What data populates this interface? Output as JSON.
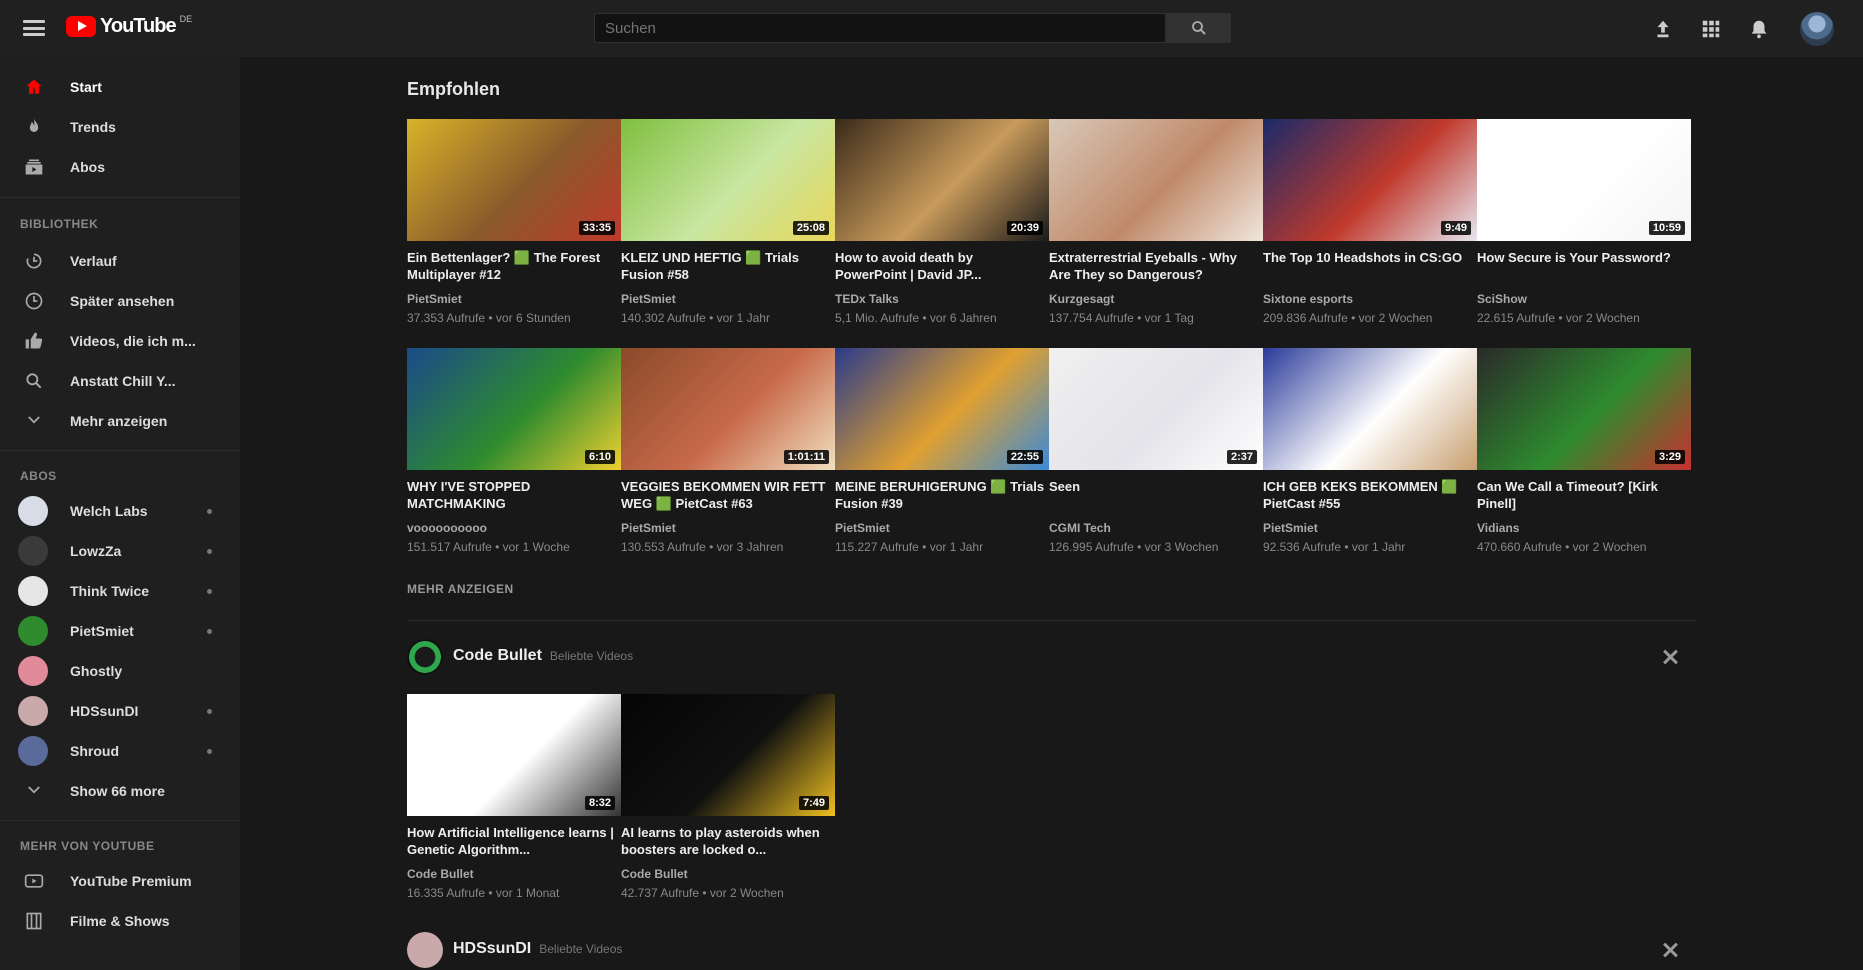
{
  "header": {
    "logo_text": "YouTube",
    "logo_sup": "DE",
    "search_placeholder": "Suchen"
  },
  "sidebar": {
    "main_items": [
      {
        "label": "Start",
        "icon": "home-icon"
      },
      {
        "label": "Trends",
        "icon": "flame-icon"
      },
      {
        "label": "Abos",
        "icon": "subscriptions-icon"
      }
    ],
    "library_heading": "BIBLIOTHEK",
    "library_items": [
      {
        "label": "Verlauf",
        "icon": "history-icon"
      },
      {
        "label": "Später ansehen",
        "icon": "clock-icon"
      },
      {
        "label": "Videos, die ich m...",
        "icon": "thumbs-up-icon"
      },
      {
        "label": "Anstatt Chill Y...",
        "icon": "playlist-icon"
      },
      {
        "label": "Mehr anzeigen",
        "icon": "chevron-down-icon"
      }
    ],
    "abos_heading": "ABOS",
    "subscriptions": [
      {
        "label": "Welch Labs",
        "color": "#d8dce6"
      },
      {
        "label": "LowzZa",
        "color": "#3a3a3a"
      },
      {
        "label": "Think Twice",
        "color": "#e6e6e6"
      },
      {
        "label": "PietSmiet",
        "color": "#2e8b2e"
      },
      {
        "label": "Ghostly",
        "color": "#e08a9a"
      },
      {
        "label": "HDSsunDI",
        "color": "#c9a9a9"
      },
      {
        "label": "Shroud",
        "color": "#5a6a9a"
      },
      {
        "label": "Show 66 more",
        "color": ""
      }
    ],
    "more_heading": "MEHR VON YOUTUBE",
    "more_items": [
      {
        "label": "YouTube Premium",
        "icon": "premium-icon"
      },
      {
        "label": "Filme & Shows",
        "icon": "film-icon"
      }
    ]
  },
  "main": {
    "recommended_title": "Empfohlen",
    "show_more": "MEHR ANZEIGEN",
    "videos": [
      {
        "title": "Ein Bettenlager? 🟩 The Forest Multiplayer #12",
        "channel": "PietSmiet",
        "meta": "37.353 Aufrufe • vor 6 Stunden",
        "duration": "33:35",
        "colors": [
          "#d8b32a",
          "#8a5a2a",
          "#c0392b"
        ]
      },
      {
        "title": "KLEIZ UND HEFTIG 🟩 Trials Fusion #58",
        "channel": "PietSmiet",
        "meta": "140.302 Aufrufe • vor 1 Jahr",
        "duration": "25:08",
        "colors": [
          "#7fbf3f",
          "#c8e6a0",
          "#e8d75a"
        ]
      },
      {
        "title": "How to avoid death by PowerPoint | David JP...",
        "channel": "TEDx Talks",
        "meta": "5,1 Mio. Aufrufe • vor 6 Jahren",
        "duration": "20:39",
        "colors": [
          "#3a2a1a",
          "#c89a5a",
          "#1a1a1a"
        ]
      },
      {
        "title": "Extraterrestrial Eyeballs - Why Are They so Dangerous?",
        "channel": "Kurzgesagt",
        "meta": "137.754 Aufrufe • vor 1 Tag",
        "duration": "",
        "colors": [
          "#d8c8b8",
          "#c08a6a",
          "#f0e6dc"
        ]
      },
      {
        "title": "The Top 10 Headshots in CS:GO",
        "channel": "Sixtone esports",
        "meta": "209.836 Aufrufe • vor 2 Wochen",
        "duration": "9:49",
        "colors": [
          "#1a2a6a",
          "#c0392b",
          "#e6e6f0"
        ]
      },
      {
        "title": "How Secure is Your Password?",
        "channel": "SciShow",
        "meta": "22.615 Aufrufe • vor 2 Wochen",
        "duration": "10:59",
        "colors": [
          "#ffffff",
          "#ffffff",
          "#f4f4f4"
        ]
      },
      {
        "title": "WHY I'VE STOPPED MATCHMAKING",
        "channel": "voooooooooo",
        "meta": "151.517 Aufrufe • vor 1 Woche",
        "duration": "6:10",
        "colors": [
          "#1a4a8a",
          "#2e8b2e",
          "#f0d030"
        ]
      },
      {
        "title": "VEGGIES BEKOMMEN WIR FETT WEG 🟩 PietCast #63",
        "channel": "PietSmiet",
        "meta": "130.553 Aufrufe • vor 3 Jahren",
        "duration": "1:01:11",
        "colors": [
          "#8a4a2a",
          "#c86a4a",
          "#f0e0c0"
        ]
      },
      {
        "title": "MEINE BERUHIGERUNG 🟩 Trials Fusion #39",
        "channel": "PietSmiet",
        "meta": "115.227 Aufrufe • vor 1 Jahr",
        "duration": "22:55",
        "colors": [
          "#2a3a8a",
          "#e0a030",
          "#3a8ad8"
        ]
      },
      {
        "title": "Seen",
        "channel": "CGMI Tech",
        "meta": "126.995 Aufrufe • vor 3 Wochen",
        "duration": "2:37",
        "colors": [
          "#f0f0f0",
          "#e4e4ea",
          "#ffffff"
        ]
      },
      {
        "title": "ICH GEB KEKS BEKOMMEN 🟩 PietCast #55",
        "channel": "PietSmiet",
        "meta": "92.536 Aufrufe • vor 1 Jahr",
        "duration": "",
        "colors": [
          "#2a3a9a",
          "#ffffff",
          "#c8a070"
        ]
      },
      {
        "title": "Can We Call a Timeout? [Kirk Pinell]",
        "channel": "Vidians",
        "meta": "470.660 Aufrufe • vor 2 Wochen",
        "duration": "3:29",
        "colors": [
          "#2a2a2a",
          "#2e8b2e",
          "#c83030"
        ]
      }
    ],
    "code_bullet_shelf": {
      "name": "Code Bullet",
      "subtitle": "Beliebte Videos",
      "videos": [
        {
          "title": "How Artificial Intelligence learns | Genetic Algorithm...",
          "channel": "Code Bullet",
          "meta": "16.335 Aufrufe • vor 1 Monat",
          "duration": "8:32",
          "colors": [
            "#ffffff",
            "#ffffff",
            "#333333"
          ]
        },
        {
          "title": "AI learns to play asteroids when boosters are locked o...",
          "channel": "Code Bullet",
          "meta": "42.737 Aufrufe • vor 2 Wochen",
          "duration": "7:49",
          "colors": [
            "#050505",
            "#101010",
            "#f0c020"
          ]
        }
      ]
    },
    "hdssundi_shelf": {
      "name": "HDSsunDI",
      "subtitle": "Beliebte Videos"
    }
  }
}
